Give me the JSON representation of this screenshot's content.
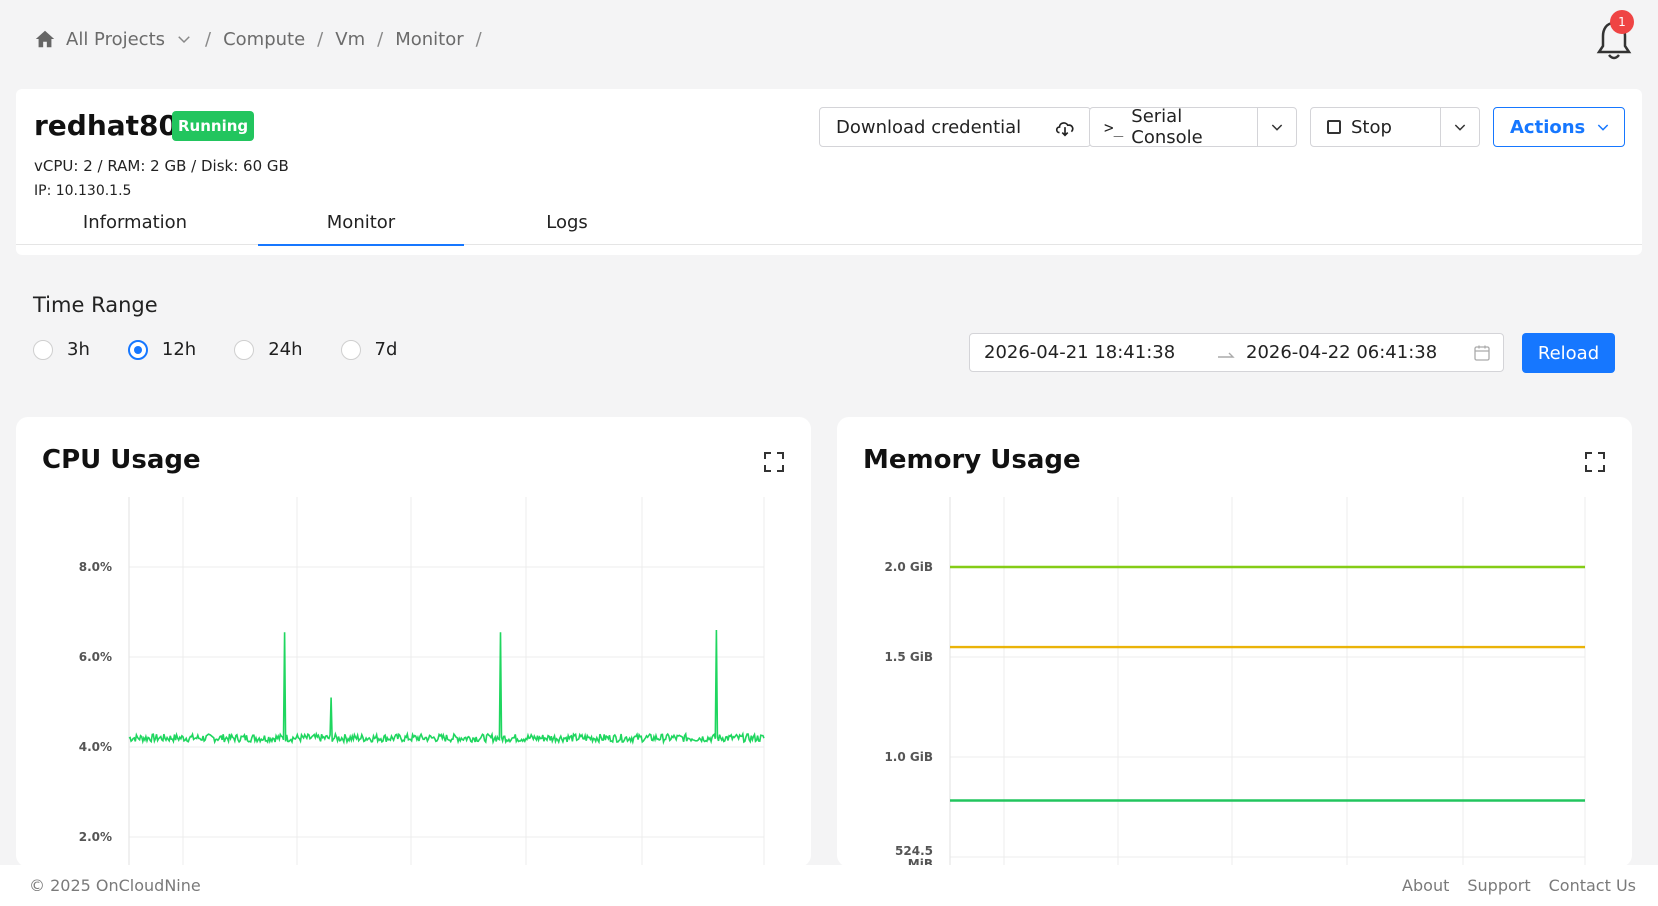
{
  "breadcrumb": {
    "project": "All Projects",
    "items": [
      "Compute",
      "Vm",
      "Monitor"
    ]
  },
  "notifications": {
    "count": "1"
  },
  "vm": {
    "name": "redhat80",
    "status": "Running",
    "spec": "vCPU: 2 / RAM: 2 GB / Disk: 60 GB",
    "ip": "IP: 10.130.1.5"
  },
  "buttons": {
    "download": "Download credential",
    "serial_prompt": ">_",
    "serial": "Serial Console",
    "stop": "Stop",
    "actions": "Actions",
    "reload": "Reload"
  },
  "tabs": [
    "Information",
    "Monitor",
    "Logs"
  ],
  "active_tab": "Monitor",
  "time_range": {
    "title": "Time Range",
    "options": [
      "3h",
      "12h",
      "24h",
      "7d"
    ],
    "selected": "12h",
    "start": "2026-04-21 18:41:38",
    "end": "2026-04-22 06:41:38"
  },
  "colors": {
    "accent": "#1677ff",
    "running": "#22c55e",
    "cpu_line": "#1fd65f",
    "mem_total": "#84cc16",
    "mem_used": "#eab308",
    "mem_free": "#22c55e"
  },
  "chart_data": [
    {
      "type": "line",
      "title": "CPU Usage",
      "yticks": [
        "8.0%",
        "6.0%",
        "4.0%",
        "2.0%"
      ],
      "ylim": [
        0.0,
        8.2
      ],
      "baseline": 4.2,
      "spikes": [
        {
          "x": 0.245,
          "y": 6.55
        },
        {
          "x": 0.318,
          "y": 5.1
        },
        {
          "x": 0.585,
          "y": 6.55
        },
        {
          "x": 0.925,
          "y": 6.6
        }
      ],
      "grid": true
    },
    {
      "type": "line",
      "title": "Memory Usage",
      "yticks": [
        "2.0 GiB",
        "1.5 GiB",
        "1.0 GiB",
        "524.5 MiB"
      ],
      "series": [
        {
          "level": 2.0,
          "color": "#84cc16"
        },
        {
          "level": 1.49,
          "color": "#eab308"
        },
        {
          "level": 0.512,
          "color": "#22c55e"
        }
      ],
      "grid": true
    }
  ],
  "footer": {
    "copyright": "© 2025 OnCloudNine",
    "links": [
      "About",
      "Support",
      "Contact Us"
    ]
  }
}
